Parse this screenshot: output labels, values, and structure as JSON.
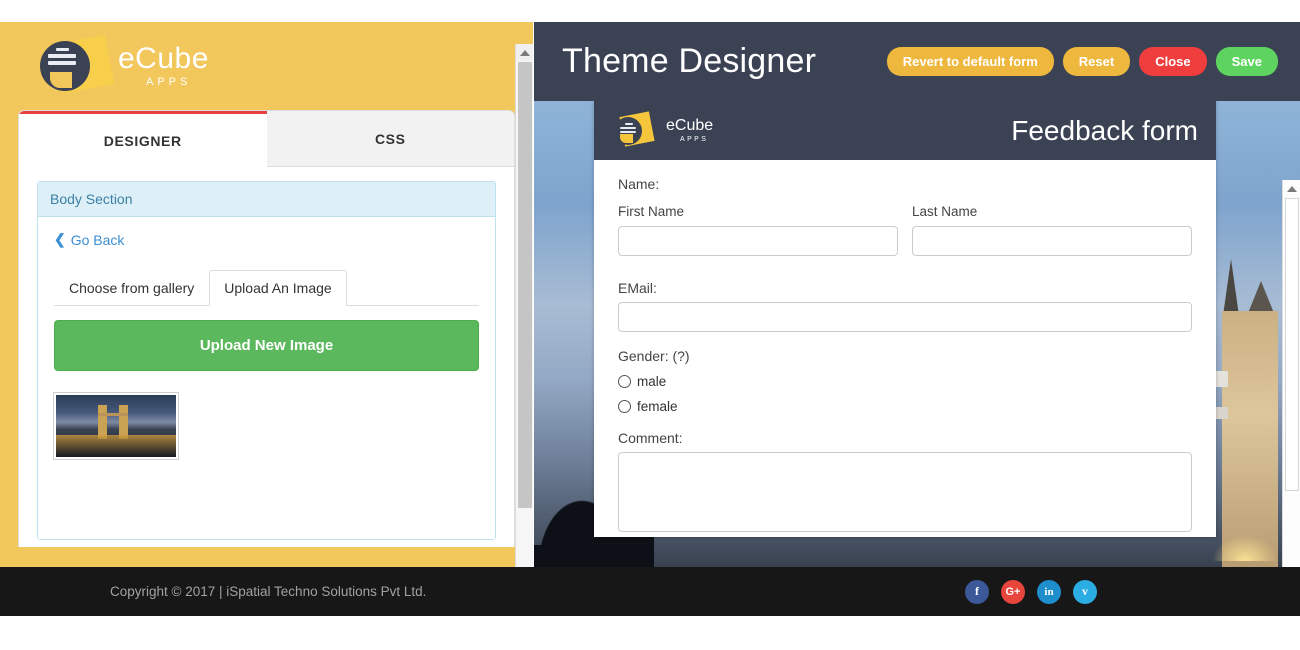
{
  "left_panel": {
    "brand": {
      "name": "eCube",
      "sub": "APPS",
      "logo_icon": "ecube-logo-icon"
    },
    "tabs": [
      {
        "label": "DESIGNER",
        "active": true
      },
      {
        "label": "CSS",
        "active": false
      }
    ],
    "section": {
      "title": "Body Section",
      "go_back": "Go Back",
      "back_icon": "chevron-left-icon",
      "subtabs": [
        {
          "label": "Choose from gallery",
          "active": false
        },
        {
          "label": "Upload An Image",
          "active": true
        }
      ],
      "upload_button": "Upload New Image",
      "thumbnail_alt": "tower-bridge-night-thumbnail"
    }
  },
  "right_panel": {
    "header": {
      "title": "Theme Designer",
      "buttons": [
        {
          "label": "Revert to default form",
          "color": "#eeb83f"
        },
        {
          "label": "Reset",
          "color": "#eeb83f"
        },
        {
          "label": "Close",
          "color": "#f03e3e"
        },
        {
          "label": "Save",
          "color": "#5fd35f"
        }
      ]
    },
    "preview": {
      "background_alt": "tower-bridge-background-image",
      "form": {
        "brand": {
          "name": "eCube",
          "sub": "APPS"
        },
        "title": "Feedback form",
        "name_label": "Name:",
        "first_name_label": "First Name",
        "first_name_value": "",
        "first_name_placeholder": "",
        "last_name_label": "Last Name",
        "last_name_value": "",
        "last_name_placeholder": "",
        "email_label": "EMail:",
        "email_value": "",
        "email_placeholder": "",
        "gender_label": "Gender: (?)",
        "gender_options": [
          {
            "label": "male",
            "selected": false
          },
          {
            "label": "female",
            "selected": false
          }
        ],
        "comment_label": "Comment:",
        "comment_value": "",
        "comment_placeholder": ""
      }
    }
  },
  "footer": {
    "copyright": "Copyright © 2017 | iSpatial Techno Solutions Pvt Ltd.",
    "socials": [
      {
        "name": "facebook-icon",
        "glyph": "f",
        "color": "#3b5998"
      },
      {
        "name": "google-plus-icon",
        "glyph": "G+",
        "color": "#e8453c"
      },
      {
        "name": "linkedin-icon",
        "glyph": "in",
        "color": "#1d8ecb"
      },
      {
        "name": "twitter-icon",
        "glyph": "ᴠ",
        "color": "#2bace2"
      }
    ]
  },
  "theme": {
    "brand_yellow": "#f2c75c",
    "navy": "#3b4254",
    "accent_red": "#e8413c",
    "green": "#5cb85c",
    "link_blue": "#3b8fd4",
    "section_blue": "#def0f7"
  }
}
